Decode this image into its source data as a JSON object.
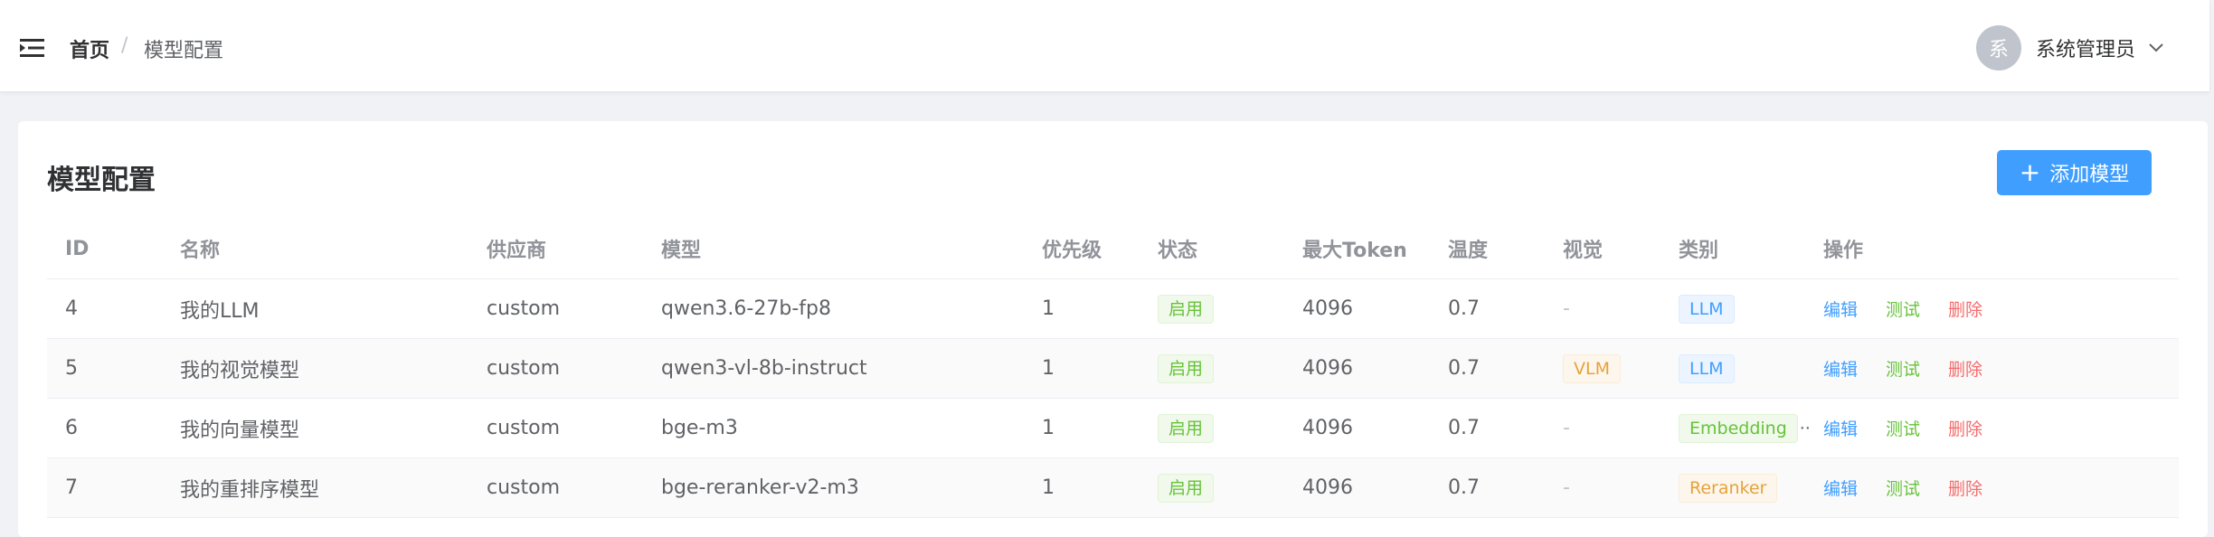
{
  "header": {
    "breadcrumb_home": "首页",
    "breadcrumb_separator": "/",
    "breadcrumb_current": "模型配置",
    "avatar_text": "系",
    "user_name": "系统管理员"
  },
  "page": {
    "title": "模型配置",
    "add_button_plus": "+",
    "add_button_label": "添加模型"
  },
  "table": {
    "columns": [
      "ID",
      "名称",
      "供应商",
      "模型",
      "优先级",
      "状态",
      "最大Token",
      "温度",
      "视觉",
      "类别",
      "操作"
    ],
    "rows": [
      {
        "id": "4",
        "name": "我的LLM",
        "provider": "custom",
        "model": "qwen3.6-27b-fp8",
        "priority": "1",
        "status": "启用",
        "max_token": "4096",
        "temperature": "0.7",
        "vision": "-",
        "category": "LLM",
        "category_ellipsis": ""
      },
      {
        "id": "5",
        "name": "我的视觉模型",
        "provider": "custom",
        "model": "qwen3-vl-8b-instruct",
        "priority": "1",
        "status": "启用",
        "max_token": "4096",
        "temperature": "0.7",
        "vision": "VLM",
        "category": "LLM",
        "category_ellipsis": ""
      },
      {
        "id": "6",
        "name": "我的向量模型",
        "provider": "custom",
        "model": "bge-m3",
        "priority": "1",
        "status": "启用",
        "max_token": "4096",
        "temperature": "0.7",
        "vision": "-",
        "category": "Embedding",
        "category_ellipsis": "··"
      },
      {
        "id": "7",
        "name": "我的重排序模型",
        "provider": "custom",
        "model": "bge-reranker-v2-m3",
        "priority": "1",
        "status": "启用",
        "max_token": "4096",
        "temperature": "0.7",
        "vision": "-",
        "category": "Reranker",
        "category_ellipsis": ""
      }
    ],
    "actions": {
      "edit": "编辑",
      "test": "测试",
      "delete": "删除"
    }
  },
  "colors": {
    "primary": "#409eff",
    "success": "#67c23a",
    "warning": "#e6a23c",
    "danger": "#f56c6c",
    "page_background": "#f0f2f5"
  },
  "icons": {
    "menu": "menu-fold-icon",
    "user_menu": "chevron-down-icon",
    "add": "plus-icon"
  }
}
